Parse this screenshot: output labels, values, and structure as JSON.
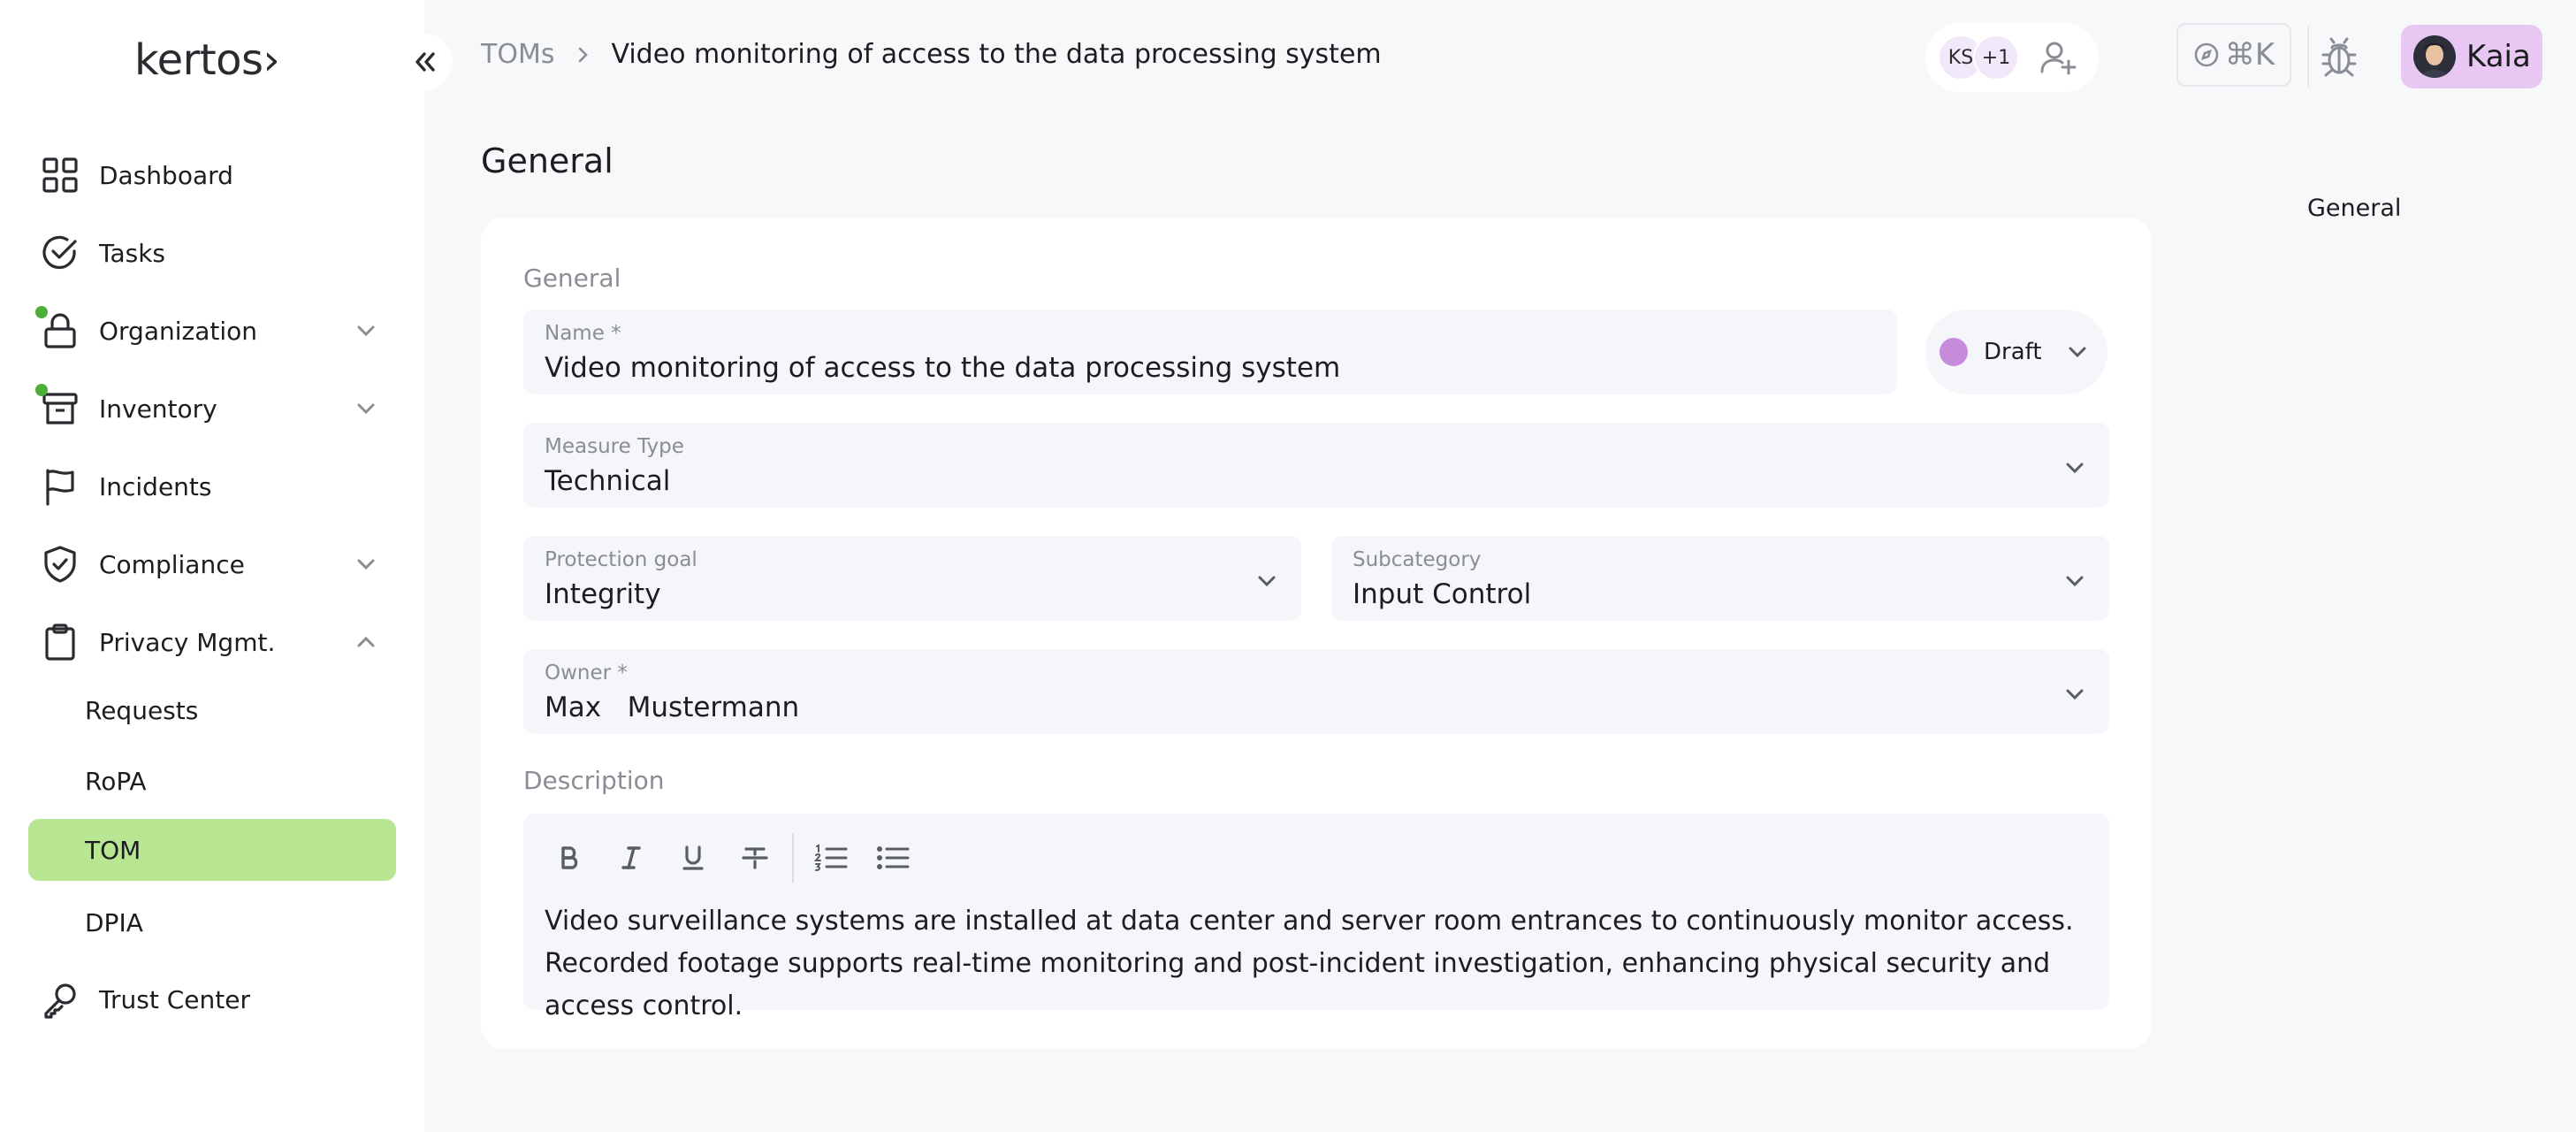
{
  "app": {
    "logo": "kertos›"
  },
  "sidebar": {
    "items": [
      {
        "label": "Dashboard"
      },
      {
        "label": "Tasks"
      },
      {
        "label": "Organization"
      },
      {
        "label": "Inventory"
      },
      {
        "label": "Incidents"
      },
      {
        "label": "Compliance"
      },
      {
        "label": "Privacy Mgmt."
      },
      {
        "label": "Trust Center"
      }
    ],
    "privacy_sub": [
      {
        "label": "Requests"
      },
      {
        "label": "RoPA"
      },
      {
        "label": "TOM",
        "active": true
      },
      {
        "label": "DPIA"
      }
    ],
    "active_color": "#b8e693"
  },
  "breadcrumb": {
    "parent": "TOMs",
    "current": "Video monitoring of access to the data processing system"
  },
  "collaborators": {
    "initials": "KS",
    "more": "+1"
  },
  "shortcut": {
    "key": "⌘K"
  },
  "user": {
    "name": "Kaia"
  },
  "page": {
    "title": "General",
    "toc": [
      "General"
    ]
  },
  "form": {
    "section": "General",
    "name": {
      "label": "Name *",
      "value": "Video monitoring of access to the data processing system"
    },
    "status": {
      "label": "Draft",
      "color": "#c68bdb"
    },
    "measure_type": {
      "label": "Measure Type",
      "value": "Technical"
    },
    "protection_goal": {
      "label": "Protection goal",
      "value": "Integrity"
    },
    "subcategory": {
      "label": "Subcategory",
      "value": "Input Control"
    },
    "owner": {
      "label": "Owner *",
      "value": "Max   Mustermann"
    },
    "description": {
      "label": "Description",
      "text": "Video surveillance systems are installed at data center and server room entrances to continuously monitor access. Recorded footage supports real-time monitoring and post-incident investigation, enhancing physical security and access control."
    }
  }
}
